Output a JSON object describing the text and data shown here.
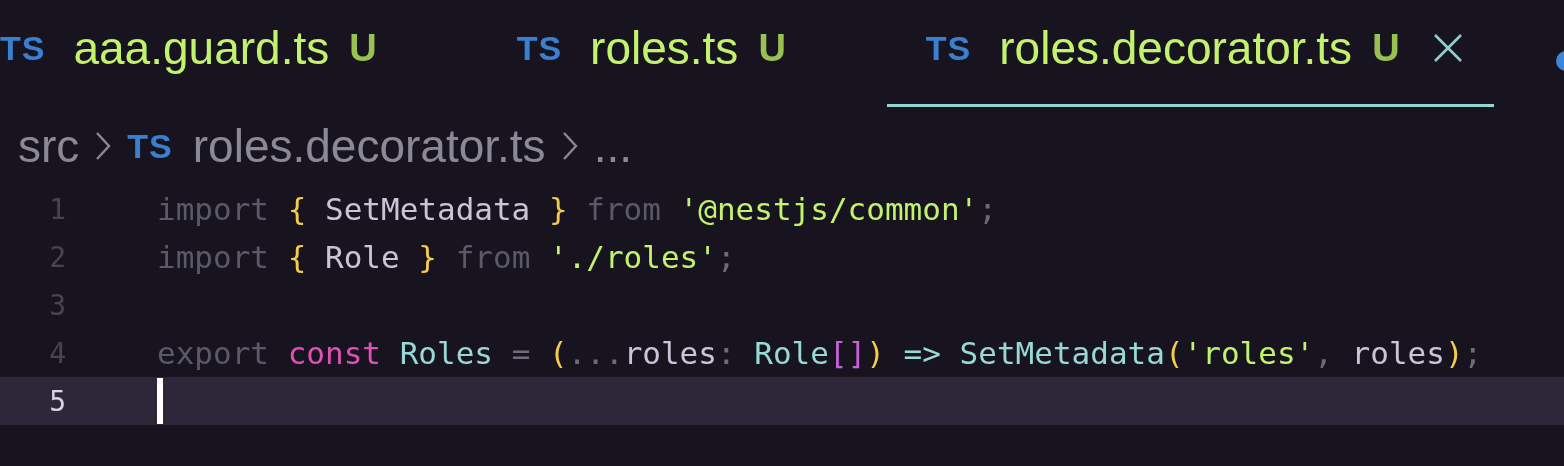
{
  "tabs": [
    {
      "file_type": "TS",
      "label": "aaa.guard.ts",
      "status": "U",
      "selected": false
    },
    {
      "file_type": "TS",
      "label": "roles.ts",
      "status": "U",
      "selected": false
    },
    {
      "file_type": "TS",
      "label": "roles.decorator.ts",
      "status": "U",
      "selected": true
    }
  ],
  "breadcrumb": {
    "folder": "src",
    "file_type": "TS",
    "file": "roles.decorator.ts",
    "more": "..."
  },
  "editor": {
    "lines": [
      {
        "number": "1",
        "current": false,
        "tokens": [
          {
            "kind": "keyword",
            "text": "import "
          },
          {
            "kind": "brace",
            "text": "{ "
          },
          {
            "kind": "ident",
            "text": "SetMetadata "
          },
          {
            "kind": "brace",
            "text": "} "
          },
          {
            "kind": "keyword",
            "text": "from "
          },
          {
            "kind": "string",
            "text": "'@nestjs/common'"
          },
          {
            "kind": "punct",
            "text": ";"
          }
        ]
      },
      {
        "number": "2",
        "current": false,
        "tokens": [
          {
            "kind": "keyword",
            "text": "import "
          },
          {
            "kind": "brace",
            "text": "{ "
          },
          {
            "kind": "ident",
            "text": "Role "
          },
          {
            "kind": "brace",
            "text": "} "
          },
          {
            "kind": "keyword",
            "text": "from "
          },
          {
            "kind": "string",
            "text": "'./roles'"
          },
          {
            "kind": "punct",
            "text": ";"
          }
        ]
      },
      {
        "number": "3",
        "current": false
      },
      {
        "number": "4",
        "current": false,
        "tokens": [
          {
            "kind": "keyword",
            "text": "export "
          },
          {
            "kind": "storage",
            "text": "const "
          },
          {
            "kind": "type",
            "text": "Roles "
          },
          {
            "kind": "punct",
            "text": "= "
          },
          {
            "kind": "brace",
            "text": "("
          },
          {
            "kind": "punct",
            "text": "..."
          },
          {
            "kind": "ident",
            "text": "roles"
          },
          {
            "kind": "punct",
            "text": ": "
          },
          {
            "kind": "type",
            "text": "Role"
          },
          {
            "kind": "bracket",
            "text": "[]"
          },
          {
            "kind": "brace",
            "text": ") "
          },
          {
            "kind": "type",
            "text": "=> "
          },
          {
            "kind": "type",
            "text": "SetMetadata"
          },
          {
            "kind": "brace",
            "text": "("
          },
          {
            "kind": "string",
            "text": "'roles'"
          },
          {
            "kind": "punct",
            "text": ", "
          },
          {
            "kind": "ident",
            "text": "roles"
          },
          {
            "kind": "brace",
            "text": ")"
          },
          {
            "kind": "punct",
            "text": ";"
          }
        ]
      },
      {
        "number": "5",
        "current": true
      }
    ]
  }
}
